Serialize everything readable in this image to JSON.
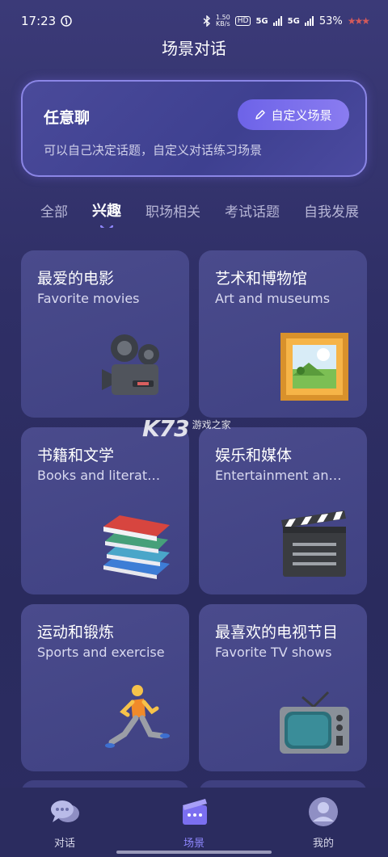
{
  "status": {
    "time": "17:23",
    "net_speed": "1.50",
    "net_unit": "KB/s",
    "hd": "HD",
    "sig1": "5G",
    "sig2": "5G",
    "battery": "53%"
  },
  "header": {
    "title": "场景对话"
  },
  "free_chat": {
    "title": "任意聊",
    "description": "可以自己决定话题，自定义对话练习场景",
    "button_label": "自定义场景"
  },
  "tabs": [
    {
      "label": "全部"
    },
    {
      "label": "兴趣"
    },
    {
      "label": "职场相关"
    },
    {
      "label": "考试话题"
    },
    {
      "label": "自我发展"
    }
  ],
  "active_tab": "兴趣",
  "scenes": [
    {
      "zh": "最爱的电影",
      "en": "Favorite movies",
      "icon": "movie-camera-icon"
    },
    {
      "zh": "艺术和博物馆",
      "en": "Art and museums",
      "icon": "framed-picture-icon"
    },
    {
      "zh": "书籍和文学",
      "en": "Books and literat…",
      "icon": "books-icon"
    },
    {
      "zh": "娱乐和媒体",
      "en": "Entertainment an…",
      "icon": "clapper-board-icon"
    },
    {
      "zh": "运动和锻炼",
      "en": "Sports and exercise",
      "icon": "runner-icon"
    },
    {
      "zh": "最喜欢的电视节目",
      "en": "Favorite TV shows",
      "icon": "television-icon"
    }
  ],
  "watermark": {
    "logo": "K73",
    "text": "游戏之家"
  },
  "bottom_nav": [
    {
      "label": "对话",
      "icon": "chat-bubbles-icon"
    },
    {
      "label": "场景",
      "icon": "scene-clapper-icon"
    },
    {
      "label": "我的",
      "icon": "profile-icon"
    }
  ],
  "active_nav": "场景"
}
